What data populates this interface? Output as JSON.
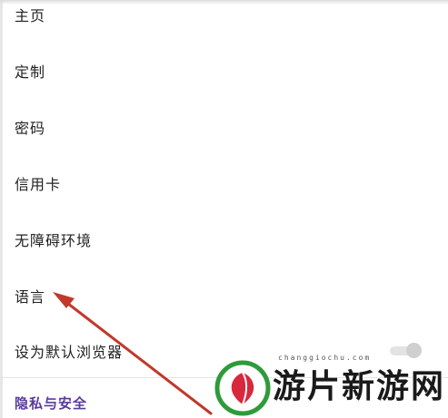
{
  "settings_menu": {
    "items": [
      {
        "label": "主页"
      },
      {
        "label": "定制"
      },
      {
        "label": "密码"
      },
      {
        "label": "信用卡"
      },
      {
        "label": "无障碍环境"
      },
      {
        "label": "语言"
      },
      {
        "label": "设为默认浏览器"
      }
    ],
    "default_browser_toggle": {
      "state": "off"
    },
    "section_header": "隐私与安全"
  },
  "annotation": {
    "arrow_color": "#c0392b",
    "points_to": "语言"
  },
  "watermark": {
    "brand_text": "游片新游网",
    "url_text": "changgiochu.com"
  },
  "colors": {
    "section_header": "#5b3a9e",
    "text": "#222222",
    "toggle_off": "#cfcfcf"
  }
}
